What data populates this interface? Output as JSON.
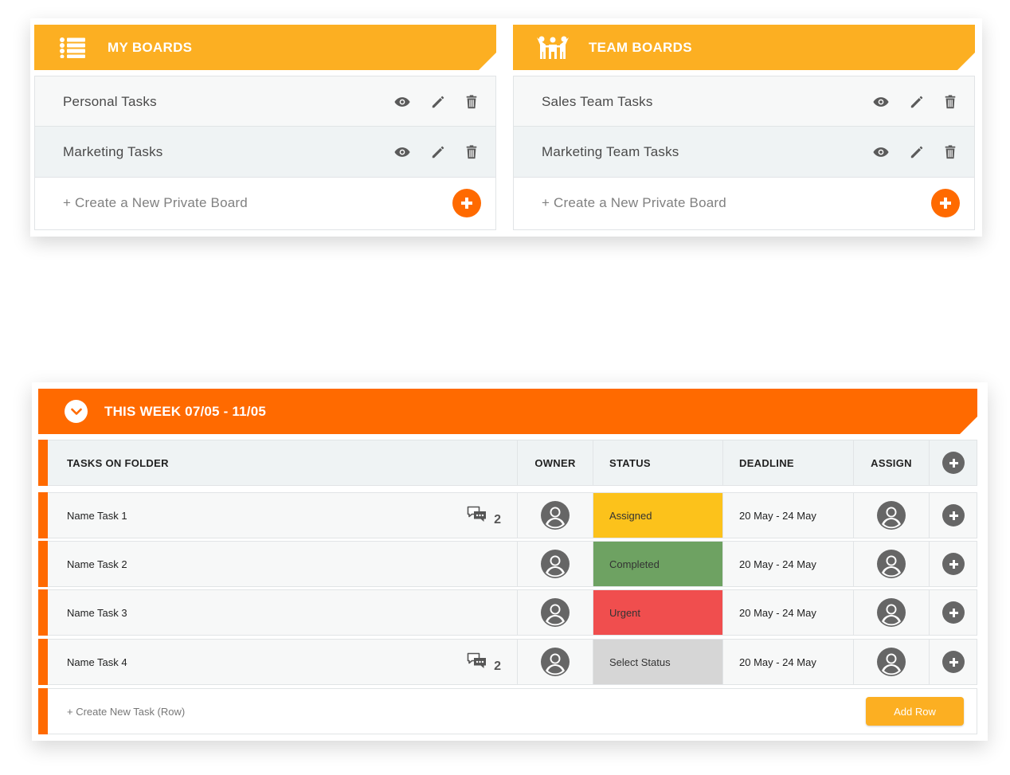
{
  "colors": {
    "accent_yellow": "#fcaf22",
    "accent_orange": "#ff6a00",
    "assigned": "#fcc21b",
    "completed": "#6ea262",
    "urgent": "#f04e4e",
    "select_status": "#d6d6d6"
  },
  "my_boards": {
    "title": "MY BOARDS",
    "icon": "list-icon",
    "items": [
      {
        "label": "Personal Tasks"
      },
      {
        "label": "Marketing Tasks"
      }
    ],
    "create_label": "+ Create a New Private Board"
  },
  "team_boards": {
    "title": "TEAM BOARDS",
    "icon": "team-icon",
    "items": [
      {
        "label": "Sales Team Tasks"
      },
      {
        "label": "Marketing Team Tasks"
      }
    ],
    "create_label": "+ Create a New Private Board"
  },
  "week": {
    "title": "THIS WEEK 07/05 - 11/05",
    "columns": {
      "tasks": "TASKS ON FOLDER",
      "owner": "OWNER",
      "status": "STATUS",
      "deadline": "DEADLINE",
      "assign": "ASSIGN"
    },
    "rows": [
      {
        "name": "Name Task 1",
        "comments": "2",
        "status": "Assigned",
        "deadline": "20 May - 24 May"
      },
      {
        "name": "Name Task 2",
        "comments": "",
        "status": "Completed",
        "deadline": "20 May - 24 May"
      },
      {
        "name": "Name Task 3",
        "comments": "",
        "status": "Urgent",
        "deadline": "20 May - 24 May"
      },
      {
        "name": "Name Task 4",
        "comments": "2",
        "status": "Select Status",
        "deadline": "20 May - 24 May"
      }
    ],
    "create_label": "+ Create New Task (Row)",
    "add_row_label": "Add Row"
  }
}
